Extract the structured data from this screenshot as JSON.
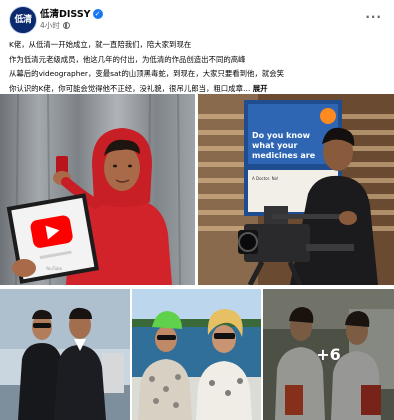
{
  "header": {
    "avatar_text": "低清",
    "page_name": "低清DISSY",
    "verified_icon": "✓",
    "timestamp": "4小时",
    "privacy_icon": "globe-icon",
    "more_icon": "···"
  },
  "post": {
    "lines": [
      "K佬，从低清一开始成立，就一直陪我们，陪大家到现在",
      "作为低清元老级成员，他这几年的付出，为低清的作品创造出不同的高峰",
      "从幕后的videographer，变最sat的山顶黑毒蛇，到现在，大家只要看到他，就会笑",
      "你认识的K佬，你可能会觉得他不正经，没礼貌，很吊儿郎当，粗口成章…"
    ],
    "see_more": "展开"
  },
  "gallery": {
    "more_count": "+6",
    "photo1_sign": "YouTube"
  },
  "photo2_poster": {
    "line1": "Do you know",
    "line2": "what your",
    "line3": "medicines are",
    "line4": "A Doctor. No!"
  },
  "colors": {
    "accent": "#1877f2",
    "text": "#050505",
    "secondary": "#65676b",
    "hoodie_red": "#d2232a",
    "youtube_red": "#ff0000"
  }
}
